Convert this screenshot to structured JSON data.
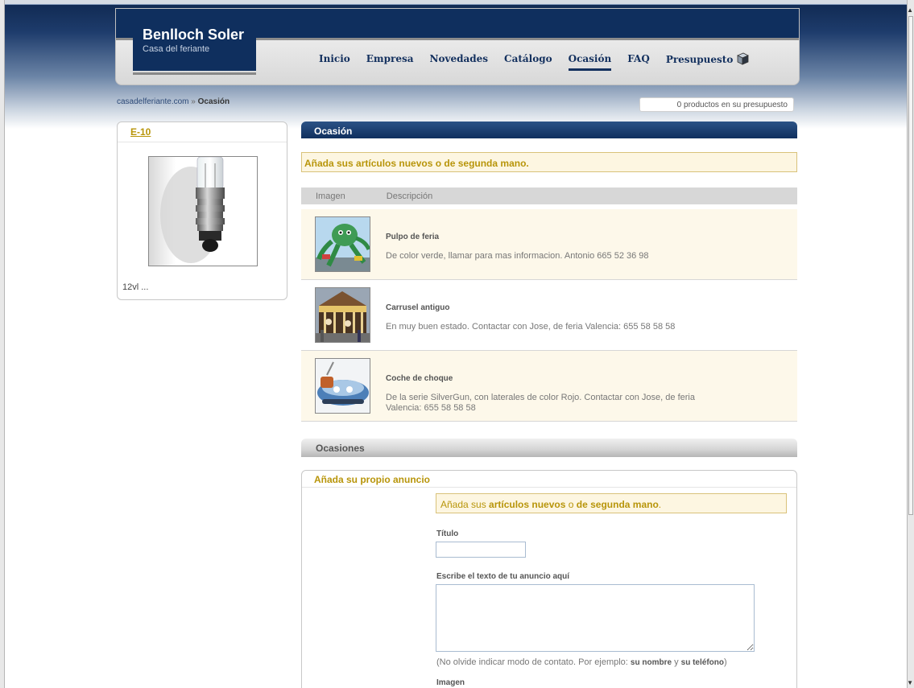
{
  "site": {
    "name": "Benlloch Soler",
    "tagline": "Casa del feriante"
  },
  "nav": {
    "items": [
      "Inicio",
      "Empresa",
      "Novedades",
      "Catálogo",
      "Ocasión",
      "FAQ",
      "Presupuesto"
    ],
    "active": "Ocasión"
  },
  "breadcrumb": {
    "home": "casadelferiante.com",
    "separator": "»",
    "current": "Ocasión"
  },
  "cart": {
    "summary": "0 productos en su presupuesto"
  },
  "sidebar": {
    "product_title": "E-10",
    "product_caption": "12vl ..."
  },
  "main": {
    "section_title": "Ocasión",
    "notice": "Añada sus artículos nuevos o de segunda mano.",
    "table_headers": [
      "Imagen",
      "Descripción"
    ],
    "items": [
      {
        "title": "Pulpo de feria",
        "description": "De color verde, llamar para mas informacion. Antonio 665 52 36 98"
      },
      {
        "title": "Carrusel antiguo",
        "description": "En muy buen estado. Contactar con Jose, de feria Valencia: 655 58 58 58"
      },
      {
        "title": "Coche de choque",
        "description": "De la serie SilverGun, con laterales de color Rojo. Contactar con Jose, de feria Valencia: 655 58 58 58"
      }
    ],
    "occasions_title": "Ocasiones"
  },
  "form": {
    "title": "Añada su propio anuncio",
    "notice_prefix": "Añada sus ",
    "notice_bold1": "artículos nuevos",
    "notice_mid": " o ",
    "notice_bold2": "de segunda mano",
    "notice_suffix": ".",
    "title_label": "Título",
    "text_label": "Escribe el texto de tu anuncio aquí",
    "hint_prefix": "(No olvide indicar modo de contato. Por ejemplo: ",
    "hint_bold1": "su nombre",
    "hint_mid": " y ",
    "hint_bold2": "su teléfono",
    "hint_suffix": ")",
    "image_label": "Imagen"
  },
  "colors": {
    "brand_navy": "#0f2f5e",
    "accent_gold": "#b8950a",
    "notice_bg": "#fdf6e1"
  }
}
